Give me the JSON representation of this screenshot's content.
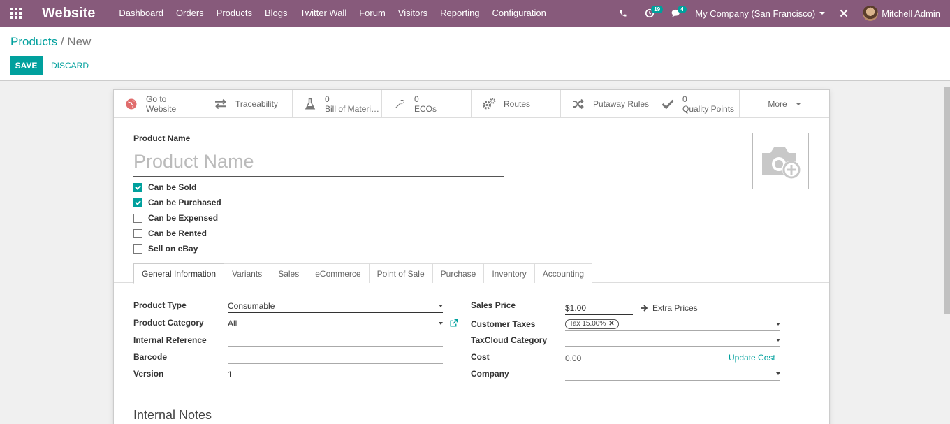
{
  "navbar": {
    "app_name": "Website",
    "menu": [
      "Dashboard",
      "Orders",
      "Products",
      "Blogs",
      "Twitter Wall",
      "Forum",
      "Visitors",
      "Reporting",
      "Configuration"
    ],
    "activity_count": "19",
    "message_count": "4",
    "company": "My Company (San Francisco)",
    "user": "Mitchell Admin",
    "brand_color": "#875a7b",
    "accent_color": "#00a09d"
  },
  "breadcrumb": {
    "parent": "Products",
    "separator": "/",
    "current": "New"
  },
  "actions": {
    "save": "SAVE",
    "discard": "DISCARD"
  },
  "smart_buttons": [
    {
      "line1": "Go to",
      "line2": "Website",
      "icon": "globe-icon"
    },
    {
      "line1": "Traceability",
      "line2": "",
      "icon": "arrows-icon"
    },
    {
      "line1": "0",
      "line2": "Bill of Materi…",
      "icon": "flask-icon"
    },
    {
      "line1": "0",
      "line2": "ECOs",
      "icon": "wrench-icon"
    },
    {
      "line1": "Routes",
      "line2": "",
      "icon": "cogs-icon"
    },
    {
      "line1": "Putaway Rules",
      "line2": "",
      "icon": "random-icon"
    },
    {
      "line1": "0",
      "line2": "Quality Points",
      "icon": "check-icon"
    }
  ],
  "more_label": "More",
  "form": {
    "product_name_label": "Product Name",
    "product_name_placeholder": "Product Name",
    "checkboxes": [
      {
        "label": "Can be Sold",
        "checked": true
      },
      {
        "label": "Can be Purchased",
        "checked": true
      },
      {
        "label": "Can be Expensed",
        "checked": false
      },
      {
        "label": "Can be Rented",
        "checked": false
      },
      {
        "label": "Sell on eBay",
        "checked": false
      }
    ],
    "tabs": [
      "General Information",
      "Variants",
      "Sales",
      "eCommerce",
      "Point of Sale",
      "Purchase",
      "Inventory",
      "Accounting"
    ],
    "left": {
      "product_type_label": "Product Type",
      "product_type_value": "Consumable",
      "product_category_label": "Product Category",
      "product_category_value": "All",
      "internal_reference_label": "Internal Reference",
      "internal_reference_value": "",
      "barcode_label": "Barcode",
      "barcode_value": "",
      "version_label": "Version",
      "version_value": "1"
    },
    "right": {
      "sales_price_label": "Sales Price",
      "sales_price_value": "$1.00",
      "extra_prices": "Extra Prices",
      "customer_taxes_label": "Customer Taxes",
      "customer_taxes_tag": "Tax 15.00%",
      "taxcloud_label": "TaxCloud Category",
      "taxcloud_value": "",
      "cost_label": "Cost",
      "cost_value": "0.00",
      "update_cost": "Update Cost",
      "company_label": "Company",
      "company_value": ""
    },
    "internal_notes": "Internal Notes"
  }
}
